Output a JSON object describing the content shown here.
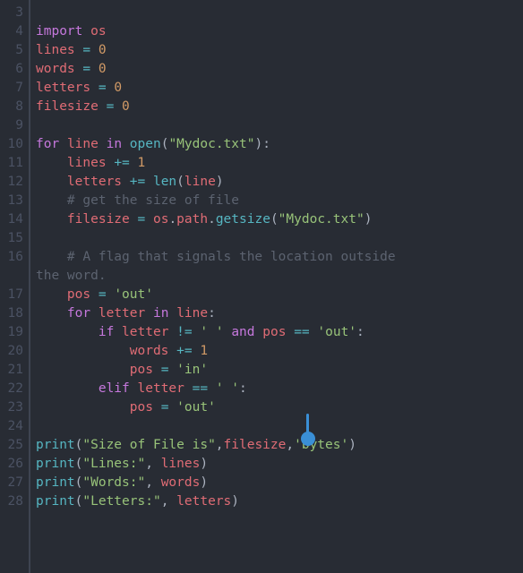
{
  "editor": {
    "language": "python",
    "first_line_number": 3,
    "gutter": [
      "3",
      "4",
      "5",
      "6",
      "7",
      "8",
      "9",
      "10",
      "11",
      "12",
      "13",
      "14",
      "15",
      "16",
      "",
      "17",
      "18",
      "19",
      "20",
      "21",
      "22",
      "23",
      "24",
      "25",
      "26",
      "27",
      "28"
    ],
    "lines": [
      [],
      [
        {
          "t": "kw",
          "v": "import"
        },
        {
          "t": "def",
          "v": " "
        },
        {
          "t": "ident",
          "v": "os"
        }
      ],
      [
        {
          "t": "ident",
          "v": "lines"
        },
        {
          "t": "def",
          "v": " "
        },
        {
          "t": "op",
          "v": "="
        },
        {
          "t": "def",
          "v": " "
        },
        {
          "t": "num",
          "v": "0"
        }
      ],
      [
        {
          "t": "ident",
          "v": "words"
        },
        {
          "t": "def",
          "v": " "
        },
        {
          "t": "op",
          "v": "="
        },
        {
          "t": "def",
          "v": " "
        },
        {
          "t": "num",
          "v": "0"
        }
      ],
      [
        {
          "t": "ident",
          "v": "letters"
        },
        {
          "t": "def",
          "v": " "
        },
        {
          "t": "op",
          "v": "="
        },
        {
          "t": "def",
          "v": " "
        },
        {
          "t": "num",
          "v": "0"
        }
      ],
      [
        {
          "t": "ident",
          "v": "filesize"
        },
        {
          "t": "def",
          "v": " "
        },
        {
          "t": "op",
          "v": "="
        },
        {
          "t": "def",
          "v": " "
        },
        {
          "t": "num",
          "v": "0"
        }
      ],
      [],
      [
        {
          "t": "kw",
          "v": "for"
        },
        {
          "t": "def",
          "v": " "
        },
        {
          "t": "ident",
          "v": "line"
        },
        {
          "t": "def",
          "v": " "
        },
        {
          "t": "kw",
          "v": "in"
        },
        {
          "t": "def",
          "v": " "
        },
        {
          "t": "bfunc",
          "v": "open"
        },
        {
          "t": "punc",
          "v": "("
        },
        {
          "t": "str",
          "v": "\"Mydoc.txt\""
        },
        {
          "t": "punc",
          "v": "):"
        }
      ],
      [
        {
          "t": "def",
          "v": "    "
        },
        {
          "t": "ident",
          "v": "lines"
        },
        {
          "t": "def",
          "v": " "
        },
        {
          "t": "op",
          "v": "+="
        },
        {
          "t": "def",
          "v": " "
        },
        {
          "t": "num",
          "v": "1"
        }
      ],
      [
        {
          "t": "def",
          "v": "    "
        },
        {
          "t": "ident",
          "v": "letters"
        },
        {
          "t": "def",
          "v": " "
        },
        {
          "t": "op",
          "v": "+="
        },
        {
          "t": "def",
          "v": " "
        },
        {
          "t": "bfunc",
          "v": "len"
        },
        {
          "t": "punc",
          "v": "("
        },
        {
          "t": "ident",
          "v": "line"
        },
        {
          "t": "punc",
          "v": ")"
        }
      ],
      [
        {
          "t": "def",
          "v": "    "
        },
        {
          "t": "cmt",
          "v": "# get the size of file"
        }
      ],
      [
        {
          "t": "def",
          "v": "    "
        },
        {
          "t": "ident",
          "v": "filesize"
        },
        {
          "t": "def",
          "v": " "
        },
        {
          "t": "op",
          "v": "="
        },
        {
          "t": "def",
          "v": " "
        },
        {
          "t": "ident",
          "v": "os"
        },
        {
          "t": "punc",
          "v": "."
        },
        {
          "t": "ident",
          "v": "path"
        },
        {
          "t": "punc",
          "v": "."
        },
        {
          "t": "func",
          "v": "getsize"
        },
        {
          "t": "punc",
          "v": "("
        },
        {
          "t": "str",
          "v": "\"Mydoc.txt\""
        },
        {
          "t": "punc",
          "v": ")"
        }
      ],
      [],
      [
        {
          "t": "def",
          "v": "    "
        },
        {
          "t": "cmt",
          "v": "# A flag that signals the location outside "
        }
      ],
      [
        {
          "t": "cmt",
          "v": "the word."
        }
      ],
      [
        {
          "t": "def",
          "v": "    "
        },
        {
          "t": "ident",
          "v": "pos"
        },
        {
          "t": "def",
          "v": " "
        },
        {
          "t": "op",
          "v": "="
        },
        {
          "t": "def",
          "v": " "
        },
        {
          "t": "str",
          "v": "'out'"
        }
      ],
      [
        {
          "t": "def",
          "v": "    "
        },
        {
          "t": "kw",
          "v": "for"
        },
        {
          "t": "def",
          "v": " "
        },
        {
          "t": "ident",
          "v": "letter"
        },
        {
          "t": "def",
          "v": " "
        },
        {
          "t": "kw",
          "v": "in"
        },
        {
          "t": "def",
          "v": " "
        },
        {
          "t": "ident",
          "v": "line"
        },
        {
          "t": "punc",
          "v": ":"
        }
      ],
      [
        {
          "t": "def",
          "v": "        "
        },
        {
          "t": "kw",
          "v": "if"
        },
        {
          "t": "def",
          "v": " "
        },
        {
          "t": "ident",
          "v": "letter"
        },
        {
          "t": "def",
          "v": " "
        },
        {
          "t": "op",
          "v": "!="
        },
        {
          "t": "def",
          "v": " "
        },
        {
          "t": "str",
          "v": "' '"
        },
        {
          "t": "def",
          "v": " "
        },
        {
          "t": "kw",
          "v": "and"
        },
        {
          "t": "def",
          "v": " "
        },
        {
          "t": "ident",
          "v": "pos"
        },
        {
          "t": "def",
          "v": " "
        },
        {
          "t": "op",
          "v": "=="
        },
        {
          "t": "def",
          "v": " "
        },
        {
          "t": "str",
          "v": "'out'"
        },
        {
          "t": "punc",
          "v": ":"
        }
      ],
      [
        {
          "t": "def",
          "v": "            "
        },
        {
          "t": "ident",
          "v": "words"
        },
        {
          "t": "def",
          "v": " "
        },
        {
          "t": "op",
          "v": "+="
        },
        {
          "t": "def",
          "v": " "
        },
        {
          "t": "num",
          "v": "1"
        }
      ],
      [
        {
          "t": "def",
          "v": "            "
        },
        {
          "t": "ident",
          "v": "pos"
        },
        {
          "t": "def",
          "v": " "
        },
        {
          "t": "op",
          "v": "="
        },
        {
          "t": "def",
          "v": " "
        },
        {
          "t": "str",
          "v": "'in'"
        }
      ],
      [
        {
          "t": "def",
          "v": "        "
        },
        {
          "t": "kw",
          "v": "elif"
        },
        {
          "t": "def",
          "v": " "
        },
        {
          "t": "ident",
          "v": "letter"
        },
        {
          "t": "def",
          "v": " "
        },
        {
          "t": "op",
          "v": "=="
        },
        {
          "t": "def",
          "v": " "
        },
        {
          "t": "str",
          "v": "' '"
        },
        {
          "t": "punc",
          "v": ":"
        }
      ],
      [
        {
          "t": "def",
          "v": "            "
        },
        {
          "t": "ident",
          "v": "pos"
        },
        {
          "t": "def",
          "v": " "
        },
        {
          "t": "op",
          "v": "="
        },
        {
          "t": "def",
          "v": " "
        },
        {
          "t": "str",
          "v": "'out'"
        }
      ],
      [],
      [
        {
          "t": "bfunc",
          "v": "print"
        },
        {
          "t": "punc",
          "v": "("
        },
        {
          "t": "str",
          "v": "\"Size of File is\""
        },
        {
          "t": "punc",
          "v": ","
        },
        {
          "t": "ident",
          "v": "filesize"
        },
        {
          "t": "punc",
          "v": ","
        },
        {
          "t": "str",
          "v": "'bytes'"
        },
        {
          "t": "punc",
          "v": ")"
        }
      ],
      [
        {
          "t": "bfunc",
          "v": "print"
        },
        {
          "t": "punc",
          "v": "("
        },
        {
          "t": "str",
          "v": "\"Lines:\""
        },
        {
          "t": "punc",
          "v": ", "
        },
        {
          "t": "ident",
          "v": "lines"
        },
        {
          "t": "punc",
          "v": ")"
        }
      ],
      [
        {
          "t": "bfunc",
          "v": "print"
        },
        {
          "t": "punc",
          "v": "("
        },
        {
          "t": "str",
          "v": "\"Words:\""
        },
        {
          "t": "punc",
          "v": ", "
        },
        {
          "t": "ident",
          "v": "words"
        },
        {
          "t": "punc",
          "v": ")"
        }
      ],
      [
        {
          "t": "bfunc",
          "v": "print"
        },
        {
          "t": "punc",
          "v": "("
        },
        {
          "t": "str",
          "v": "\"Letters:\""
        },
        {
          "t": "punc",
          "v": ", "
        },
        {
          "t": "ident",
          "v": "letters"
        },
        {
          "t": "punc",
          "v": ")"
        }
      ]
    ]
  }
}
